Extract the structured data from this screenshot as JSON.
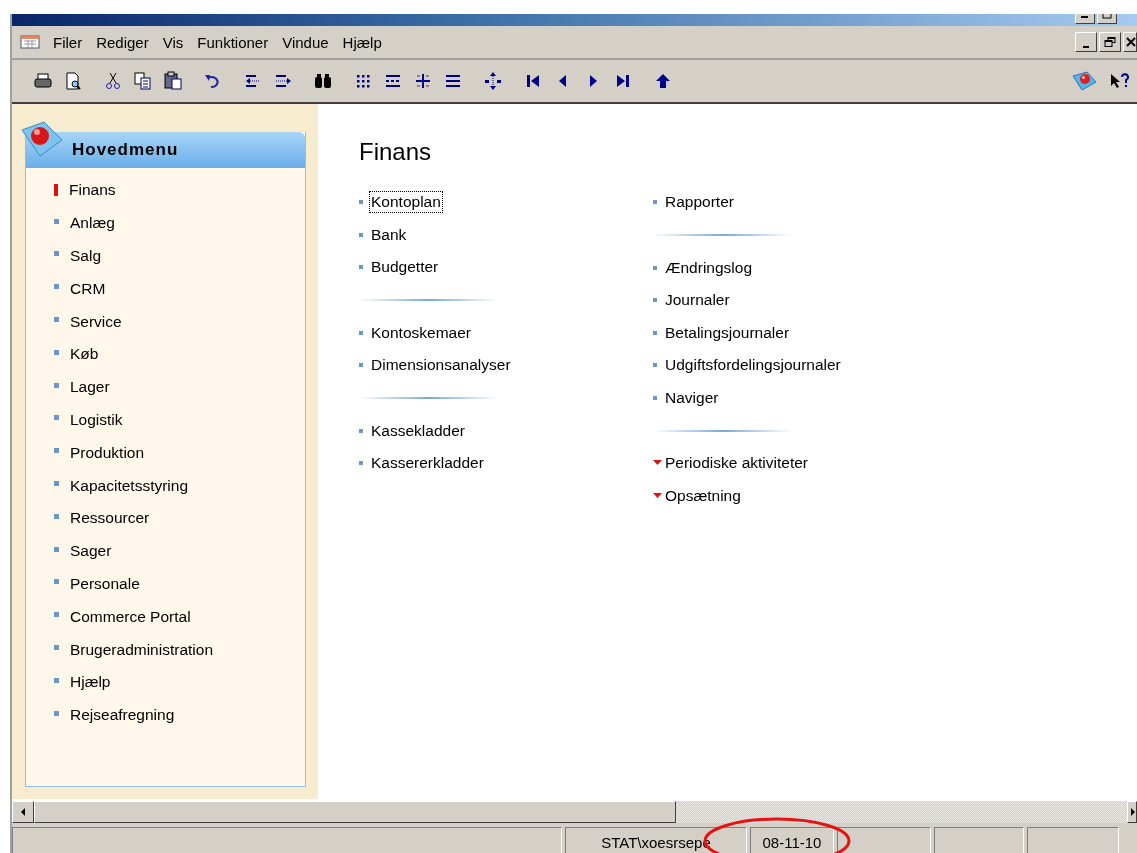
{
  "menu_bar": {
    "items": [
      "Filer",
      "Rediger",
      "Vis",
      "Funktioner",
      "Vindue",
      "Hjælp"
    ]
  },
  "sidebar": {
    "title": "Hovedmenu",
    "items": [
      {
        "label": "Finans",
        "selected": true
      },
      {
        "label": "Anlæg",
        "selected": false
      },
      {
        "label": "Salg",
        "selected": false
      },
      {
        "label": "CRM",
        "selected": false
      },
      {
        "label": "Service",
        "selected": false
      },
      {
        "label": "Køb",
        "selected": false
      },
      {
        "label": "Lager",
        "selected": false
      },
      {
        "label": "Logistik",
        "selected": false
      },
      {
        "label": "Produktion",
        "selected": false
      },
      {
        "label": "Kapacitetsstyring",
        "selected": false
      },
      {
        "label": "Ressourcer",
        "selected": false
      },
      {
        "label": "Sager",
        "selected": false
      },
      {
        "label": "Personale",
        "selected": false
      },
      {
        "label": "Commerce Portal",
        "selected": false
      },
      {
        "label": "Brugeradministration",
        "selected": false
      },
      {
        "label": "Hjælp",
        "selected": false
      },
      {
        "label": "Rejseafregning",
        "selected": false
      }
    ]
  },
  "content": {
    "title": "Finans",
    "columns": [
      [
        {
          "kind": "link",
          "label": "Kontoplan",
          "focused": true
        },
        {
          "kind": "link",
          "label": "Bank",
          "focused": false
        },
        {
          "kind": "link",
          "label": "Budgetter",
          "focused": false
        },
        {
          "kind": "separator"
        },
        {
          "kind": "link",
          "label": "Kontoskemaer",
          "focused": false
        },
        {
          "kind": "link",
          "label": "Dimensionsanalyser",
          "focused": false
        },
        {
          "kind": "separator"
        },
        {
          "kind": "link",
          "label": "Kassekladder",
          "focused": false
        },
        {
          "kind": "link",
          "label": "Kassererkladder",
          "focused": false
        }
      ],
      [
        {
          "kind": "link",
          "label": "Rapporter",
          "focused": false
        },
        {
          "kind": "separator"
        },
        {
          "kind": "link",
          "label": "Ændringslog",
          "focused": false
        },
        {
          "kind": "link",
          "label": "Journaler",
          "focused": false
        },
        {
          "kind": "link",
          "label": "Betalingsjournaler",
          "focused": false
        },
        {
          "kind": "link",
          "label": "Udgiftsfordelingsjournaler",
          "focused": false
        },
        {
          "kind": "link",
          "label": "Naviger",
          "focused": false
        },
        {
          "kind": "separator"
        },
        {
          "kind": "submenu",
          "label": "Periodiske aktiviteter",
          "focused": false
        },
        {
          "kind": "submenu",
          "label": "Opsætning",
          "focused": false
        }
      ]
    ]
  },
  "status_bar": {
    "user": "STAT\\xoesrsepe",
    "date": "08-11-10"
  }
}
